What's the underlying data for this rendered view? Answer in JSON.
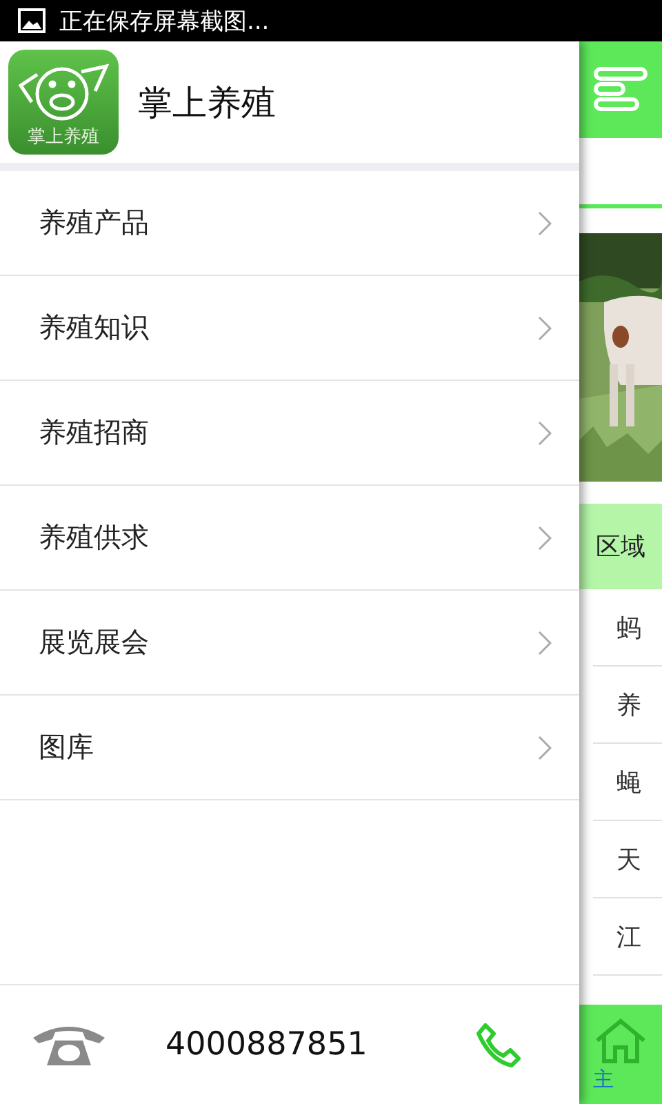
{
  "status_bar": {
    "notification": "正在保存屏幕截图..."
  },
  "drawer": {
    "app_name": "掌上养殖",
    "logo_text": "掌上养殖",
    "menu": [
      {
        "label": "养殖产品"
      },
      {
        "label": "养殖知识"
      },
      {
        "label": "养殖招商"
      },
      {
        "label": "养殖供求"
      },
      {
        "label": "展览展会"
      },
      {
        "label": "图库"
      }
    ],
    "footer": {
      "phone": "4000887851"
    }
  },
  "background_page": {
    "picture": {
      "kind": "picture"
    },
    "section_header": "区域",
    "rows": [
      "蚂",
      "养",
      "蝇",
      "天",
      "江"
    ],
    "nav": [
      {
        "label": "主",
        "selected": true
      }
    ]
  }
}
